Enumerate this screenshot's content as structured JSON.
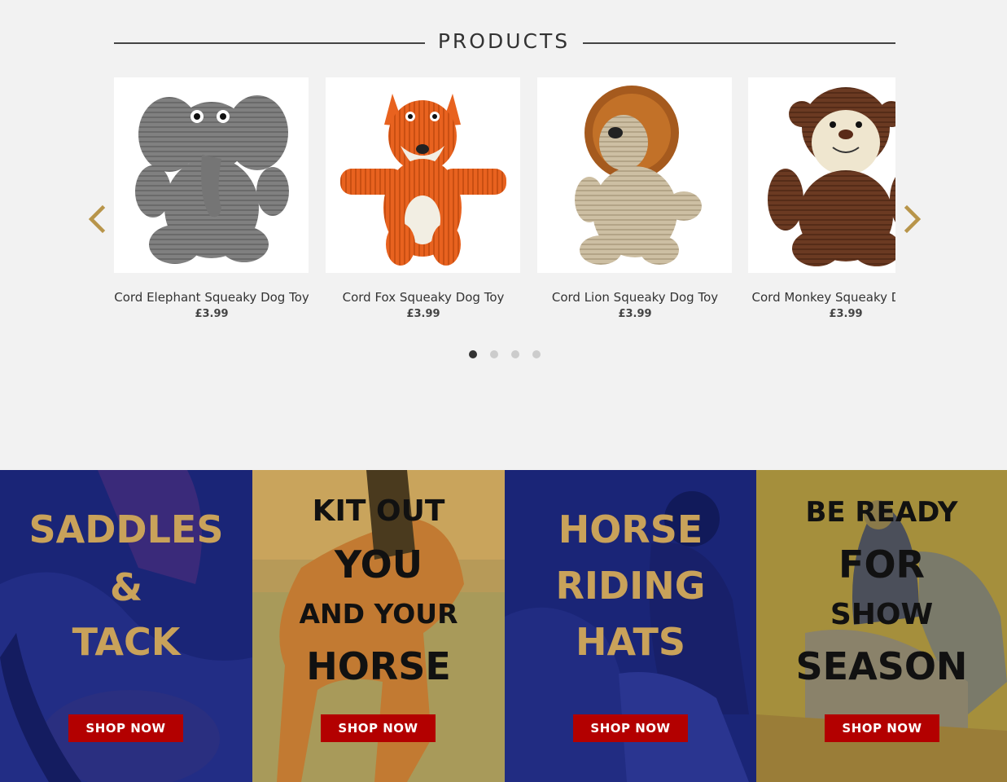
{
  "section": {
    "title": "PRODUCTS"
  },
  "products": [
    {
      "name": "Cord Elephant Squeaky Dog Toy",
      "price": "£3.99",
      "icon": "elephant-toy-image",
      "color": "#7b7b7b"
    },
    {
      "name": "Cord Fox Squeaky Dog Toy",
      "price": "£3.99",
      "icon": "fox-toy-image",
      "color": "#e8621f"
    },
    {
      "name": "Cord Lion Squeaky Dog Toy",
      "price": "£3.99",
      "icon": "lion-toy-image",
      "color": "#c8b89a"
    },
    {
      "name": "Cord Monkey Squeaky Dog Toy",
      "price": "£3.99",
      "icon": "monkey-toy-image",
      "color": "#6b3a22"
    }
  ],
  "carousel": {
    "pages": 4,
    "active_page": 1,
    "prev_icon": "chevron-left-icon",
    "next_icon": "chevron-right-icon",
    "arrow_color": "#b8954a"
  },
  "banners": [
    {
      "lines": [
        "SADDLES",
        "&",
        "TACK"
      ],
      "button": "SHOP NOW",
      "overlay_color": "#1a2577",
      "text_color": "#c9a25a"
    },
    {
      "lines": [
        "KIT OUT",
        "YOU",
        "AND YOUR",
        "HORSE"
      ],
      "button": "SHOP NOW",
      "overlay_color": "#c9a45c",
      "text_color": "#111111"
    },
    {
      "lines": [
        "HORSE",
        "RIDING",
        "HATS"
      ],
      "button": "SHOP NOW",
      "overlay_color": "#1a2577",
      "text_color": "#c9a25a"
    },
    {
      "lines": [
        "BE READY",
        "FOR",
        "SHOW",
        "SEASON"
      ],
      "button": "SHOP NOW",
      "overlay_color": "#a58f3c",
      "text_color": "#111111"
    }
  ],
  "colors": {
    "page_bg": "#f2f2f2",
    "button_red": "#b30000"
  }
}
